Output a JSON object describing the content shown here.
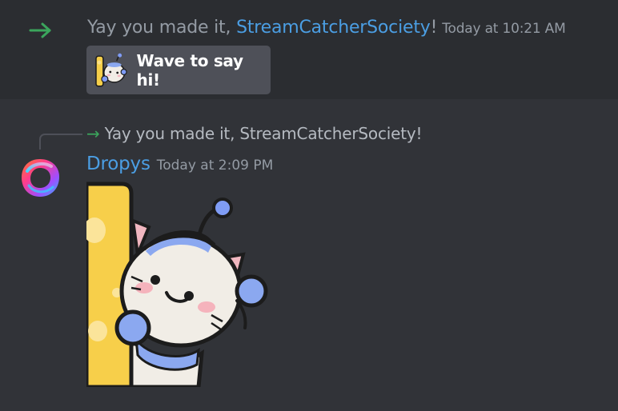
{
  "system_message": {
    "arrow_icon": "arrow-right-icon",
    "prefix": "Yay you made it, ",
    "username": "StreamCatcherSociety",
    "suffix": "!",
    "timestamp": "Today at 10:21 AM",
    "wave_button_label": "Wave to say hi!"
  },
  "reply_message": {
    "reply_preview": "Yay you made it, StreamCatcherSociety!",
    "author": "Dropys",
    "timestamp": "Today at 2:09 PM",
    "sticker": "hamster-wave-sticker"
  },
  "colors": {
    "background": "#313338",
    "highlight": "#2b2d31",
    "username": "#4b9ee3",
    "join_arrow": "#3ba55c",
    "button": "#4e5058"
  }
}
